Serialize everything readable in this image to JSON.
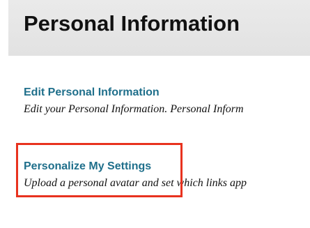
{
  "header": {
    "title": "Personal Information"
  },
  "sections": [
    {
      "link_label": "Edit Personal Information",
      "description": "Edit your Personal Information. Personal Inform"
    },
    {
      "link_label": "Personalize My Settings",
      "description": "Upload a personal avatar and set which links app"
    }
  ],
  "highlight": {
    "color": "#e8321e"
  },
  "colors": {
    "link": "#1f6f8b",
    "header_bg": "#e6e6e6"
  }
}
